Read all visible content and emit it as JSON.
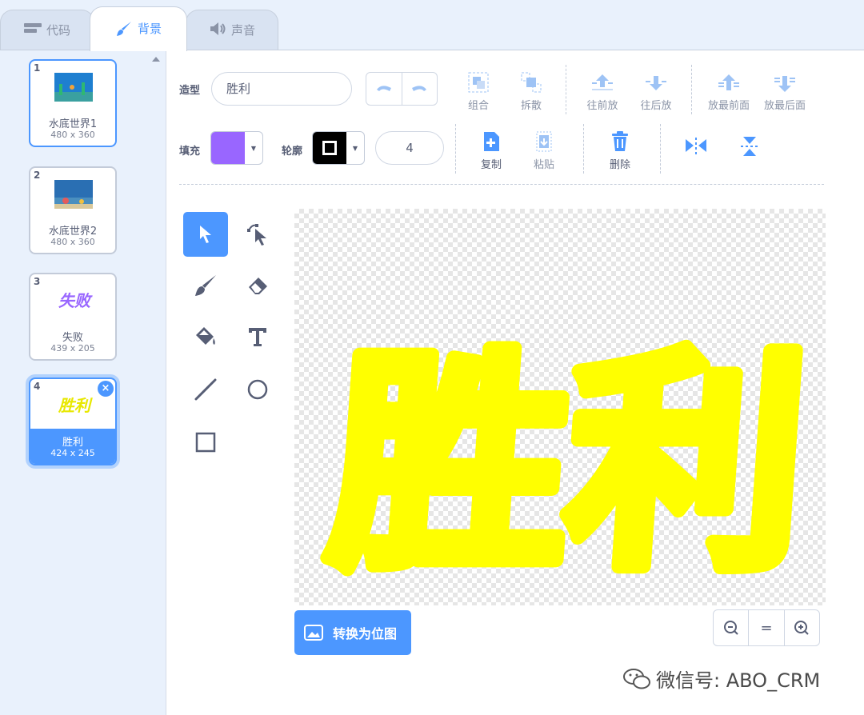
{
  "tabs": [
    {
      "label": "代码",
      "icon": "code-icon"
    },
    {
      "label": "背景",
      "icon": "brush-icon",
      "active": true
    },
    {
      "label": "声音",
      "icon": "speaker-icon"
    }
  ],
  "costumes": [
    {
      "num": "1",
      "name": "水底世界1",
      "size": "480 x 360"
    },
    {
      "num": "2",
      "name": "水底世界2",
      "size": "480 x 360"
    },
    {
      "num": "3",
      "name": "失败",
      "size": "439 x 205",
      "thumb_text": "失败"
    },
    {
      "num": "4",
      "name": "胜利",
      "size": "424 x 245",
      "thumb_text": "胜利",
      "selected": true
    }
  ],
  "toolbar": {
    "costume_label": "造型",
    "costume_name": "胜利",
    "group": "组合",
    "ungroup": "拆散",
    "forward": "往前放",
    "backward": "往后放",
    "front": "放最前面",
    "back": "放最后面",
    "fill_label": "填充",
    "outline_label": "轮廓",
    "outline_width": "4",
    "copy": "复制",
    "paste": "粘贴",
    "delete": "删除"
  },
  "colors": {
    "fill": "#9966ff",
    "outline": "#000000",
    "accent": "#4c97ff",
    "drawing": "#ffff00"
  },
  "canvas": {
    "text": "胜利"
  },
  "bottom": {
    "convert_button": "转换为位图",
    "zoom_out": "−",
    "zoom_reset": "=",
    "zoom_in": "+"
  },
  "watermark": "微信号: ABO_CRM"
}
